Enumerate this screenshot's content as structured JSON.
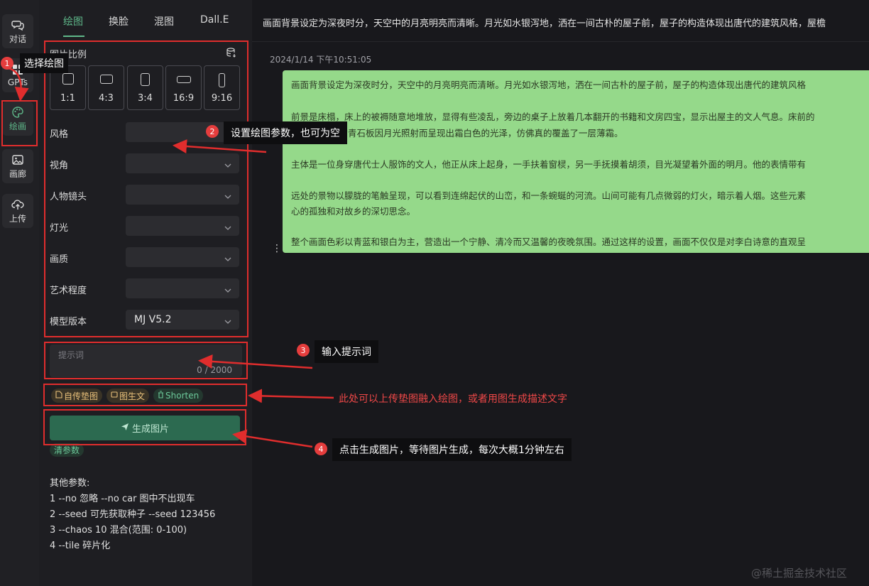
{
  "nav": {
    "items": [
      {
        "label": "对话",
        "icon": "chat-bubbles-icon"
      },
      {
        "label": "GPTs",
        "icon": "grid-icon"
      },
      {
        "label": "绘画",
        "icon": "palette-icon"
      },
      {
        "label": "画廊",
        "icon": "image-icon"
      },
      {
        "label": "上传",
        "icon": "cloud-upload-icon"
      }
    ]
  },
  "tabs": [
    "绘图",
    "换脸",
    "混图",
    "Dall.E"
  ],
  "panel": {
    "ratio_title": "图片比例",
    "ratios": [
      "1:1",
      "4:3",
      "3:4",
      "16:9",
      "9:16"
    ],
    "fields": [
      {
        "label": "风格",
        "value": ""
      },
      {
        "label": "视角",
        "value": ""
      },
      {
        "label": "人物镜头",
        "value": ""
      },
      {
        "label": "灯光",
        "value": ""
      },
      {
        "label": "画质",
        "value": ""
      },
      {
        "label": "艺术程度",
        "value": ""
      },
      {
        "label": "模型版本",
        "value": "MJ V5.2"
      }
    ],
    "prompt_placeholder": "提示词",
    "prompt_count": "0 / 2000",
    "chips": [
      "自传垫图",
      "图生文",
      "Shorten"
    ],
    "generate_label": "生成图片",
    "clear_label": "清参数",
    "other_title": "其他参数:",
    "other_lines": [
      "1 --no 忽略 --no car 图中不出现车",
      "2 --seed 可先获取种子 --seed 123456",
      "3 --chaos 10 混合(范围: 0-100)",
      "4 --tile 碎片化"
    ]
  },
  "main": {
    "header": "画面背景设定为深夜时分，天空中的月亮明亮而清晰。月光如水银泻地，洒在一间古朴的屋子前，屋子的构造体现出唐代的建筑风格，屋檐",
    "timestamp": "2024/1/14 下午10:51:05",
    "paragraphs": [
      "画面背景设定为深夜时分，天空中的月亮明亮而清晰。月光如水银泻地，洒在一间古朴的屋子前，屋子的构造体现出唐代的建筑风格",
      "前景是床榻，床上的被褥随意地堆放，显得有些凌乱，旁边的桌子上放着几本翻开的书籍和文房四宝，显示出屋主的文人气息。床前的",
      "上铺着的青石板因月光照射而呈现出霜白色的光泽，仿佛真的覆盖了一层薄霜。",
      "主体是一位身穿唐代士人服饰的文人，他正从床上起身，一手扶着窗棂，另一手抚摸着胡须，目光凝望着外面的明月。他的表情带有",
      "远处的景物以朦胧的笔触呈现，可以看到连绵起伏的山峦，和一条蜿蜒的河流。山间可能有几点微弱的灯火，暗示着人烟。这些元素",
      "心的孤独和对故乡的深切思念。",
      "整个画面色彩以青蓝和银白为主，营造出一个宁静、清冷而又温馨的夜晚氛围。通过这样的设置，画面不仅仅是对李白诗意的直观呈"
    ]
  },
  "annotations": [
    {
      "num": "1",
      "text": "选择绘图"
    },
    {
      "num": "2",
      "text": "设置绘图参数，也可为空"
    },
    {
      "num": "3",
      "text": "输入提示词"
    },
    {
      "text": "此处可以上传垫图融入绘图，或者用图生成描述文字"
    },
    {
      "num": "4",
      "text": "点击生成图片，等待图片生成，每次大概1分钟左右"
    }
  ],
  "watermark": "@稀土掘金技术社区",
  "colors": {
    "accent": "#5fb88a",
    "bubble": "#95d98a",
    "annotation": "#e02d2d"
  }
}
